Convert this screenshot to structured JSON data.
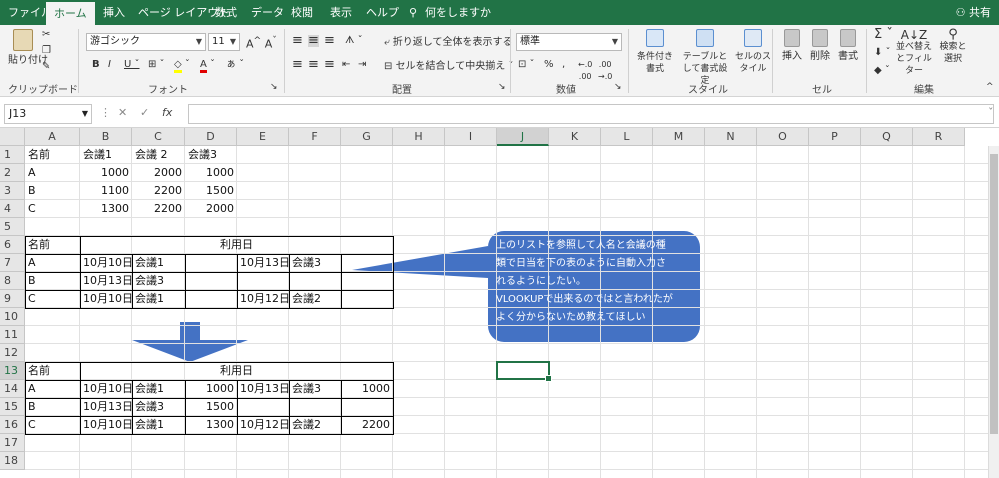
{
  "tabs": [
    "ファイル",
    "ホーム",
    "挿入",
    "ページ レイアウト",
    "数式",
    "データ",
    "校閲",
    "表示",
    "ヘルプ"
  ],
  "tell_me": "何をしますか",
  "share": "共有",
  "ribbon": {
    "paste": "貼り付け",
    "clipboard": "クリップボード",
    "font_name": "游ゴシック",
    "font_size": "11",
    "font_group": "フォント",
    "wrap_text": "折り返して全体を表示する",
    "merge_center": "セルを結合して中央揃え",
    "alignment": "配置",
    "number_format": "標準",
    "number_group": "数値",
    "cond_format": "条件付き書式",
    "format_table": "テーブルとして書式設定",
    "cell_style": "セルのスタイル",
    "styles_group": "スタイル",
    "insert": "挿入",
    "delete": "削除",
    "format": "書式",
    "cells_group": "セル",
    "sort_filter": "並べ替えとフィルター",
    "find_select": "検索と選択",
    "editing_group": "編集"
  },
  "formula_bar": {
    "name_box": "J13",
    "fx": "fx",
    "value": ""
  },
  "columns": [
    "A",
    "B",
    "C",
    "D",
    "E",
    "F",
    "G",
    "H",
    "I",
    "J",
    "K",
    "L",
    "M",
    "N",
    "O",
    "P",
    "Q",
    "R"
  ],
  "rows": [
    "1",
    "2",
    "3",
    "4",
    "5",
    "6",
    "7",
    "8",
    "9",
    "10",
    "11",
    "12",
    "13",
    "14",
    "15",
    "16",
    "17",
    "18"
  ],
  "cells": {
    "A1": "名前",
    "B1": "会議1",
    "C1": "会議 2",
    "D1": "会議3",
    "A2": "A",
    "B2": "1000",
    "C2": "2000",
    "D2": "1000",
    "A3": "B",
    "B3": "1100",
    "C3": "2200",
    "D3": "1500",
    "A4": "C",
    "B4": "1300",
    "C4": "2200",
    "D4": "2000",
    "A6": "名前",
    "D6": "利用日",
    "A7": "A",
    "B7": "10月10日",
    "C7": "会議1",
    "E7": "10月13日",
    "F7": "会議3",
    "A8": "B",
    "B8": "10月13日",
    "C8": "会議3",
    "A9": "C",
    "B9": "10月10日",
    "C9": "会議1",
    "E9": "10月12日",
    "F9": "会議2",
    "A13": "名前",
    "D13": "利用日",
    "A14": "A",
    "B14": "10月10日",
    "C14": "会議1",
    "D14": "1000",
    "E14": "10月13日",
    "F14": "会議3",
    "G14": "1000",
    "A15": "B",
    "B15": "10月13日",
    "C15": "会議3",
    "D15": "1500",
    "A16": "C",
    "B16": "10月10日",
    "C16": "会議1",
    "D16": "1300",
    "E16": "10月12日",
    "F16": "会議2",
    "G16": "2200"
  },
  "callout": {
    "line1": "上のリストを参照して人名と会議の種",
    "line2": "類で日当を下の表のように自動入力さ",
    "line3": "れるようにしたい。",
    "line4": "VLOOKUPで出来るのではと言われたが",
    "line5": "よく分からないため教えてほしい"
  },
  "colors": {
    "excel_green": "#217346",
    "callout_blue": "#4472C4"
  }
}
